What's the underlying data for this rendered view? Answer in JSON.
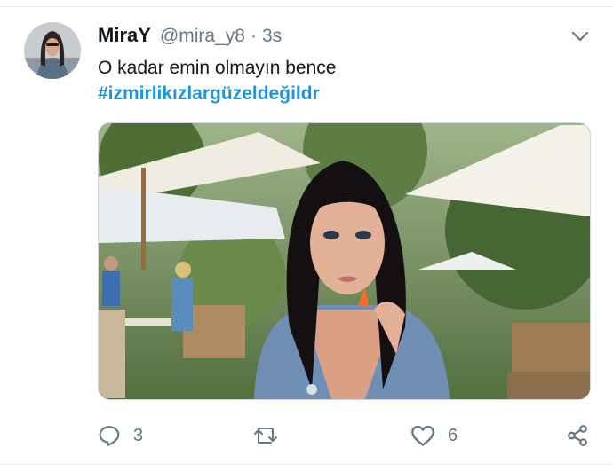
{
  "tweet": {
    "display_name": "MiraY",
    "handle": "@mira_y8",
    "separator": "·",
    "time": "3s",
    "text": "O kadar emin olmayın bence",
    "hashtag": "#izmirlikızlargüzeldeğildr"
  },
  "actions": {
    "reply_count": "3",
    "like_count": "6"
  },
  "colors": {
    "link": "#1b95e0",
    "secondary_text": "#657786",
    "primary_text": "#14171a",
    "divider": "#e6ecf0"
  },
  "icons": [
    "user-avatar",
    "chevron-down-icon",
    "reply-icon",
    "retweet-icon",
    "like-icon",
    "share-icon"
  ]
}
